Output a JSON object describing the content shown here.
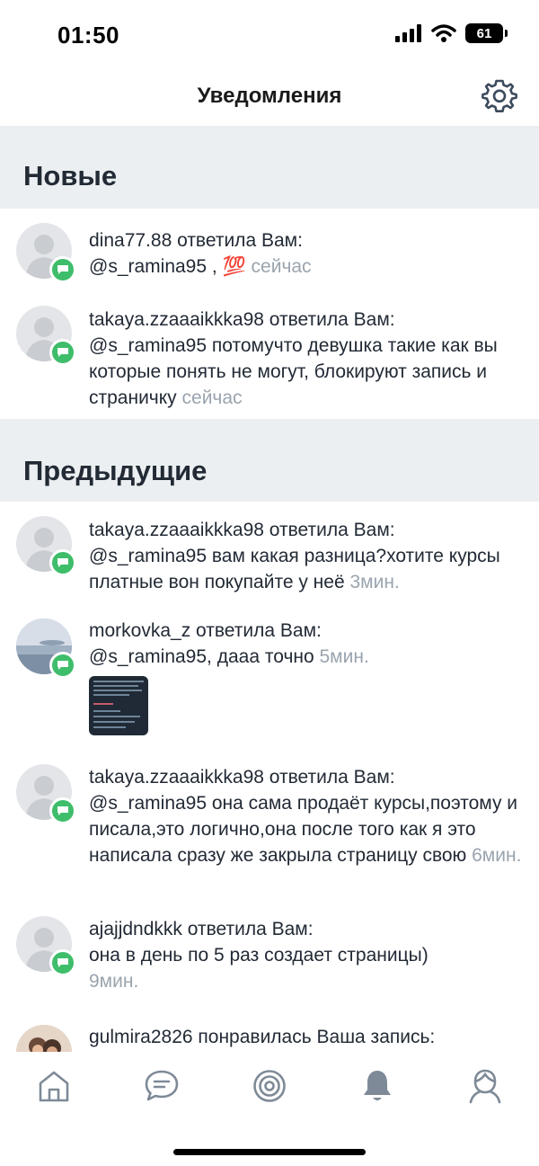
{
  "status_bar": {
    "time": "01:50",
    "battery": "61"
  },
  "header": {
    "title": "Уведомления",
    "settings_icon": "gear-icon"
  },
  "sections": {
    "new": "Новые",
    "previous": "Предыдущие"
  },
  "notifications": [
    {
      "user": "dina77.88",
      "action": " ответила Вам:",
      "body": "@s_ramina95 , 💯 ",
      "time": "сейчас",
      "avatar": "default"
    },
    {
      "user": "takaya.zzaaaikkka98",
      "action": " ответила Вам:",
      "body": "@s_ramina95 потомучто девушка такие как вы которые понять не могут, блокируют запись и страничку ",
      "time": "сейчас",
      "avatar": "default"
    },
    {
      "user": "takaya.zzaaaikkka98",
      "action": " ответила Вам:",
      "body": "@s_ramina95 вам какая разница?хотите курсы платные вон покупайте у неё ",
      "time": "3мин.",
      "avatar": "default"
    },
    {
      "user": "morkovka_z",
      "action": " ответила Вам:",
      "body": "@s_ramina95,  дааа точно ",
      "time": "5мин.",
      "avatar": "photo-sea"
    },
    {
      "user": "takaya.zzaaaikkka98",
      "action": " ответила Вам:",
      "body": "@s_ramina95 она сама продаёт курсы,поэтому и писала,это логично,она после того как я это написала сразу же закрыла страницу свою ",
      "time": "6мин.",
      "avatar": "default"
    },
    {
      "user": "ajajjdndkkk",
      "action": " ответила Вам:",
      "body": "она в день по 5 раз создает страницы)",
      "time": "9мин.",
      "avatar": "default"
    },
    {
      "user": "gulmira2826",
      "action": " понравилась Ваша запись:",
      "body": "",
      "time": "",
      "avatar": "photo-couple"
    }
  ],
  "tabbar": [
    "home-icon",
    "chat-icon",
    "target-icon",
    "bell-icon",
    "profile-icon"
  ],
  "colors": {
    "badge": "#3ebd6a",
    "section_bg": "#ebeff1",
    "muted": "#9aa4ae",
    "text": "#222a35"
  }
}
